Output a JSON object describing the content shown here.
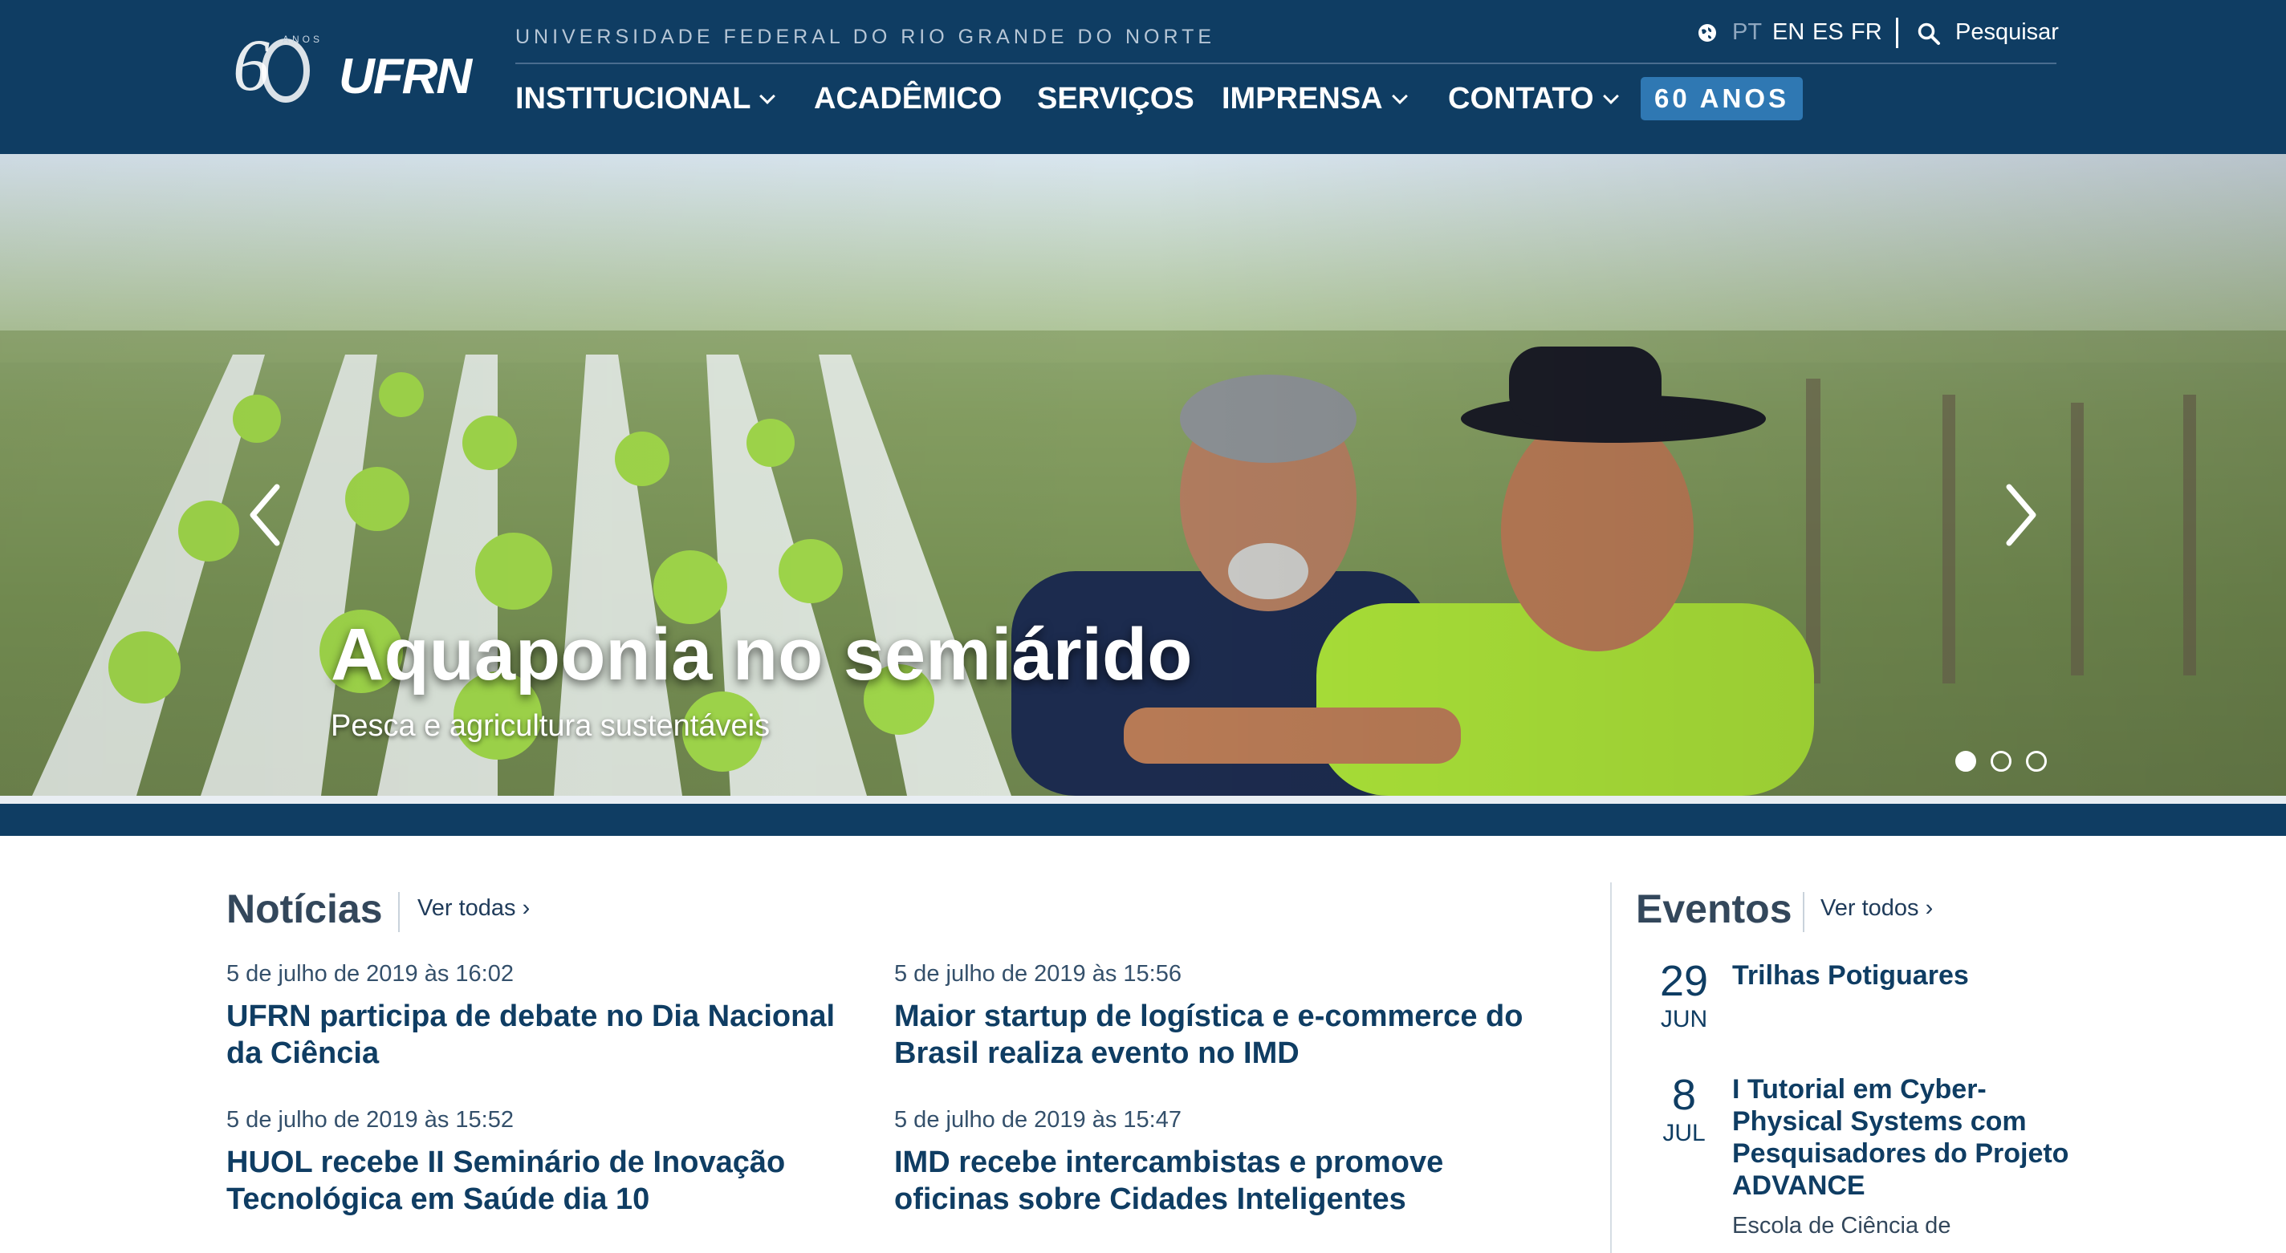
{
  "header": {
    "logo_anos": "ANOS",
    "logo_text": "UFRN",
    "university": "UNIVERSIDADE FEDERAL DO RIO GRANDE DO NORTE",
    "languages": [
      "PT",
      "EN",
      "ES",
      "FR"
    ],
    "active_language": "PT",
    "search_label": "Pesquisar",
    "nav": [
      {
        "label": "INSTITUCIONAL",
        "dropdown": true
      },
      {
        "label": "ACADÊMICO",
        "dropdown": false
      },
      {
        "label": "SERVIÇOS",
        "dropdown": false
      },
      {
        "label": "IMPRENSA",
        "dropdown": true
      },
      {
        "label": "CONTATO",
        "dropdown": true
      }
    ],
    "badge": "60 ANOS",
    "colors": {
      "header_bg": "#0f3d63",
      "badge_bg": "#2f78b3"
    }
  },
  "hero": {
    "title": "Aquaponia no semiárido",
    "subtitle": "Pesca e agricultura sustentáveis",
    "slide_count": 3,
    "active_slide": 1
  },
  "news": {
    "title": "Notícias",
    "see_all": "Ver todas ›",
    "items": [
      {
        "date": "5 de julho de 2019 às 16:02",
        "title": "UFRN participa de debate no Dia Nacional da Ciência"
      },
      {
        "date": "5 de julho de 2019 às 15:56",
        "title": "Maior startup de logística e e-commerce do Brasil realiza evento no IMD"
      },
      {
        "date": "5 de julho de 2019 às 15:52",
        "title": "HUOL recebe II Seminário de Inovação Tecnológica em Saúde dia 10"
      },
      {
        "date": "5 de julho de 2019 às 15:47",
        "title": "IMD recebe intercambistas e promove oficinas sobre Cidades Inteligentes"
      }
    ]
  },
  "events": {
    "title": "Eventos",
    "see_all": "Ver todos ›",
    "items": [
      {
        "day": "29",
        "month": "JUN",
        "title": "Trilhas Potiguares",
        "subtitle": ""
      },
      {
        "day": "8",
        "month": "JUL",
        "title": "I Tutorial em Cyber-Physical Systems com Pesquisadores do Projeto ADVANCE",
        "subtitle": "Escola de Ciência de"
      }
    ]
  }
}
